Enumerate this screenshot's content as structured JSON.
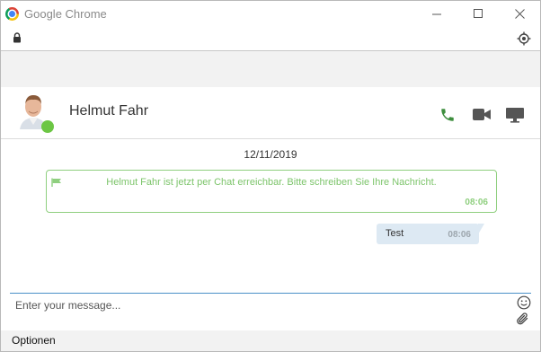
{
  "window": {
    "title": "Google Chrome",
    "icons": [
      "chrome-logo",
      "minimize-icon",
      "maximize-icon",
      "close-icon"
    ]
  },
  "addressbar": {
    "icons": [
      "lock-icon",
      "location-icon"
    ]
  },
  "contact": {
    "name": "Helmut Fahr",
    "status": "online",
    "status_color": "#6cc644",
    "actions": [
      "phone-icon",
      "video-icon",
      "screen-share-icon"
    ]
  },
  "chat": {
    "date": "12/11/2019",
    "system_message": {
      "text": "Helmut Fahr ist jetzt per Chat erreichbar. Bitte schreiben Sie Ihre Nachricht.",
      "time": "08:06",
      "color": "#7cc46a"
    },
    "messages": [
      {
        "text": "Test",
        "time": "08:06"
      }
    ]
  },
  "composer": {
    "placeholder": "Enter your message...",
    "icons": [
      "emoji-icon",
      "attachment-icon"
    ]
  },
  "footer": {
    "options_label": "Optionen"
  }
}
